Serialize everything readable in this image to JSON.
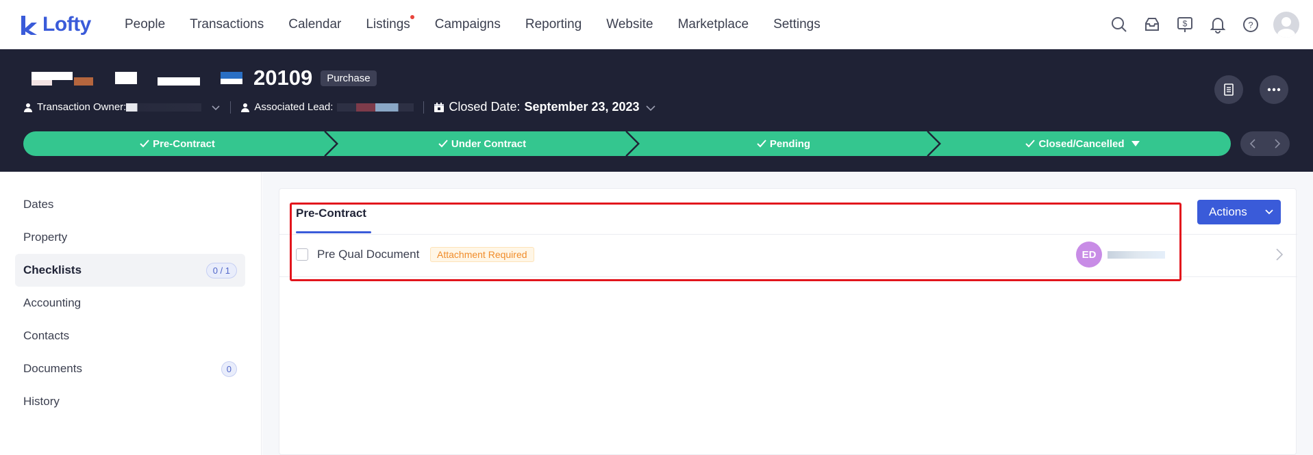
{
  "brand": {
    "name": "Lofty",
    "color": "#3a5bd9"
  },
  "nav": {
    "items": [
      {
        "label": "People"
      },
      {
        "label": "Transactions"
      },
      {
        "label": "Calendar"
      },
      {
        "label": "Listings",
        "has_dot": true
      },
      {
        "label": "Campaigns"
      },
      {
        "label": "Reporting"
      },
      {
        "label": "Website"
      },
      {
        "label": "Marketplace"
      },
      {
        "label": "Settings"
      }
    ],
    "icons": [
      "search-icon",
      "inbox-icon",
      "dollar-icon",
      "bell-icon",
      "help-icon",
      "user-avatar"
    ]
  },
  "header": {
    "title_number": "20109",
    "type_badge": "Purchase",
    "owner_label": "Transaction Owner:",
    "lead_label": "Associated Lead:",
    "closed_label": "Closed Date:",
    "closed_date": "September 23, 2023"
  },
  "stages": [
    {
      "label": "Pre-Contract",
      "done": true
    },
    {
      "label": "Under Contract",
      "done": true
    },
    {
      "label": "Pending",
      "done": true
    },
    {
      "label": "Closed/Cancelled",
      "done": true,
      "has_dropdown": true
    }
  ],
  "stage_color": "#34c68f",
  "sidebar": {
    "items": [
      {
        "label": "Dates"
      },
      {
        "label": "Property"
      },
      {
        "label": "Checklists",
        "count": "0 / 1",
        "active": true
      },
      {
        "label": "Accounting"
      },
      {
        "label": "Contacts"
      },
      {
        "label": "Documents",
        "count": "0"
      },
      {
        "label": "History"
      }
    ]
  },
  "main": {
    "tab_label": "Pre-Contract",
    "actions_label": "Actions",
    "checklist": [
      {
        "label": "Pre Qual Document",
        "badge": "Attachment Required",
        "assignee_initials": "ED"
      }
    ]
  }
}
